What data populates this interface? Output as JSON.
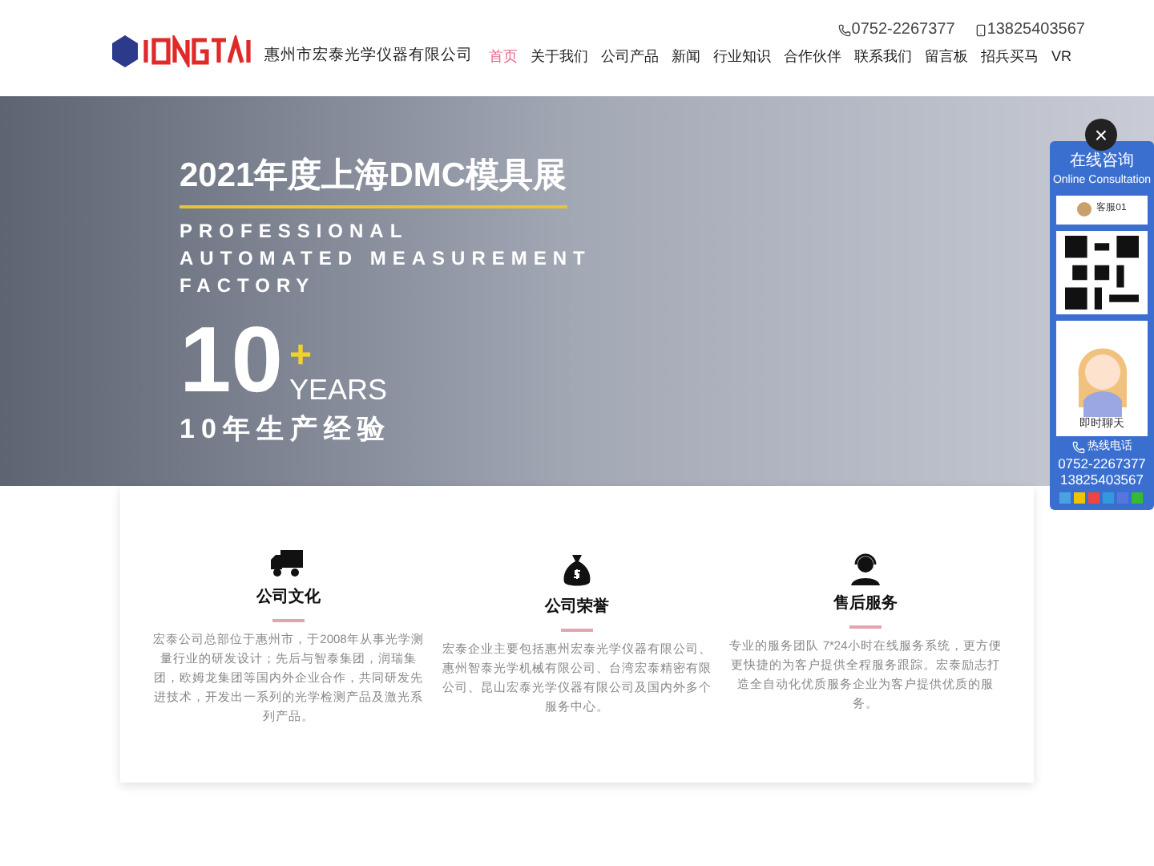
{
  "header": {
    "company_name": "惠州市宏泰光学仪器有限公司",
    "phone": "0752-2267377",
    "mobile": "13825403567",
    "nav": [
      {
        "label": "首页",
        "selected": true
      },
      {
        "label": "关于我们",
        "selected": false
      },
      {
        "label": "公司产品",
        "selected": false
      },
      {
        "label": "新闻",
        "selected": false
      },
      {
        "label": "行业知识",
        "selected": false
      },
      {
        "label": "合作伙伴",
        "selected": false
      },
      {
        "label": "联系我们",
        "selected": false
      },
      {
        "label": "留言板",
        "selected": false
      },
      {
        "label": "招兵买马",
        "selected": false
      },
      {
        "label": "VR",
        "selected": false
      }
    ]
  },
  "banner": {
    "title": "2021年度上海DMC模具展",
    "subtitle_lines": [
      "PROFESSIONAL",
      "AUTOMATED MEASUREMENT",
      "FACTORY"
    ],
    "big_number": "10",
    "plus": "+",
    "unit": "YEARS",
    "caption": "10年生产经验"
  },
  "features": [
    {
      "kind": "truck",
      "title": "公司文化",
      "text": "宏泰公司总部位于惠州市，于2008年从事光学测量行业的研发设计；先后与智泰集团，润瑞集团，欧姆龙集团等国内外企业合作，共同研发先进技术，开发出一系列的光学检测产品及激光系列产品。"
    },
    {
      "kind": "money",
      "title": "公司荣誉",
      "text": "宏泰企业主要包括惠州宏泰光学仪器有限公司、惠州智泰光学机械有限公司、台湾宏泰精密有限公司、昆山宏泰光学仪器有限公司及国内外多个服务中心。"
    },
    {
      "kind": "support",
      "title": "售后服务",
      "text": "专业的服务团队 7*24小时在线服务系统，更方便更快捷的为客户提供全程服务跟踪。宏泰励志打造全自动化优质服务企业为客户提供优质的服务。"
    }
  ],
  "chat_widget": {
    "close": "×",
    "title": "在线咨询",
    "subtitle": "Online Consultation",
    "agent": "客服01",
    "chat_label": "即时聊天",
    "hotline_label": "热线电话",
    "phones": [
      "0752-2267377",
      "13825403567"
    ]
  }
}
